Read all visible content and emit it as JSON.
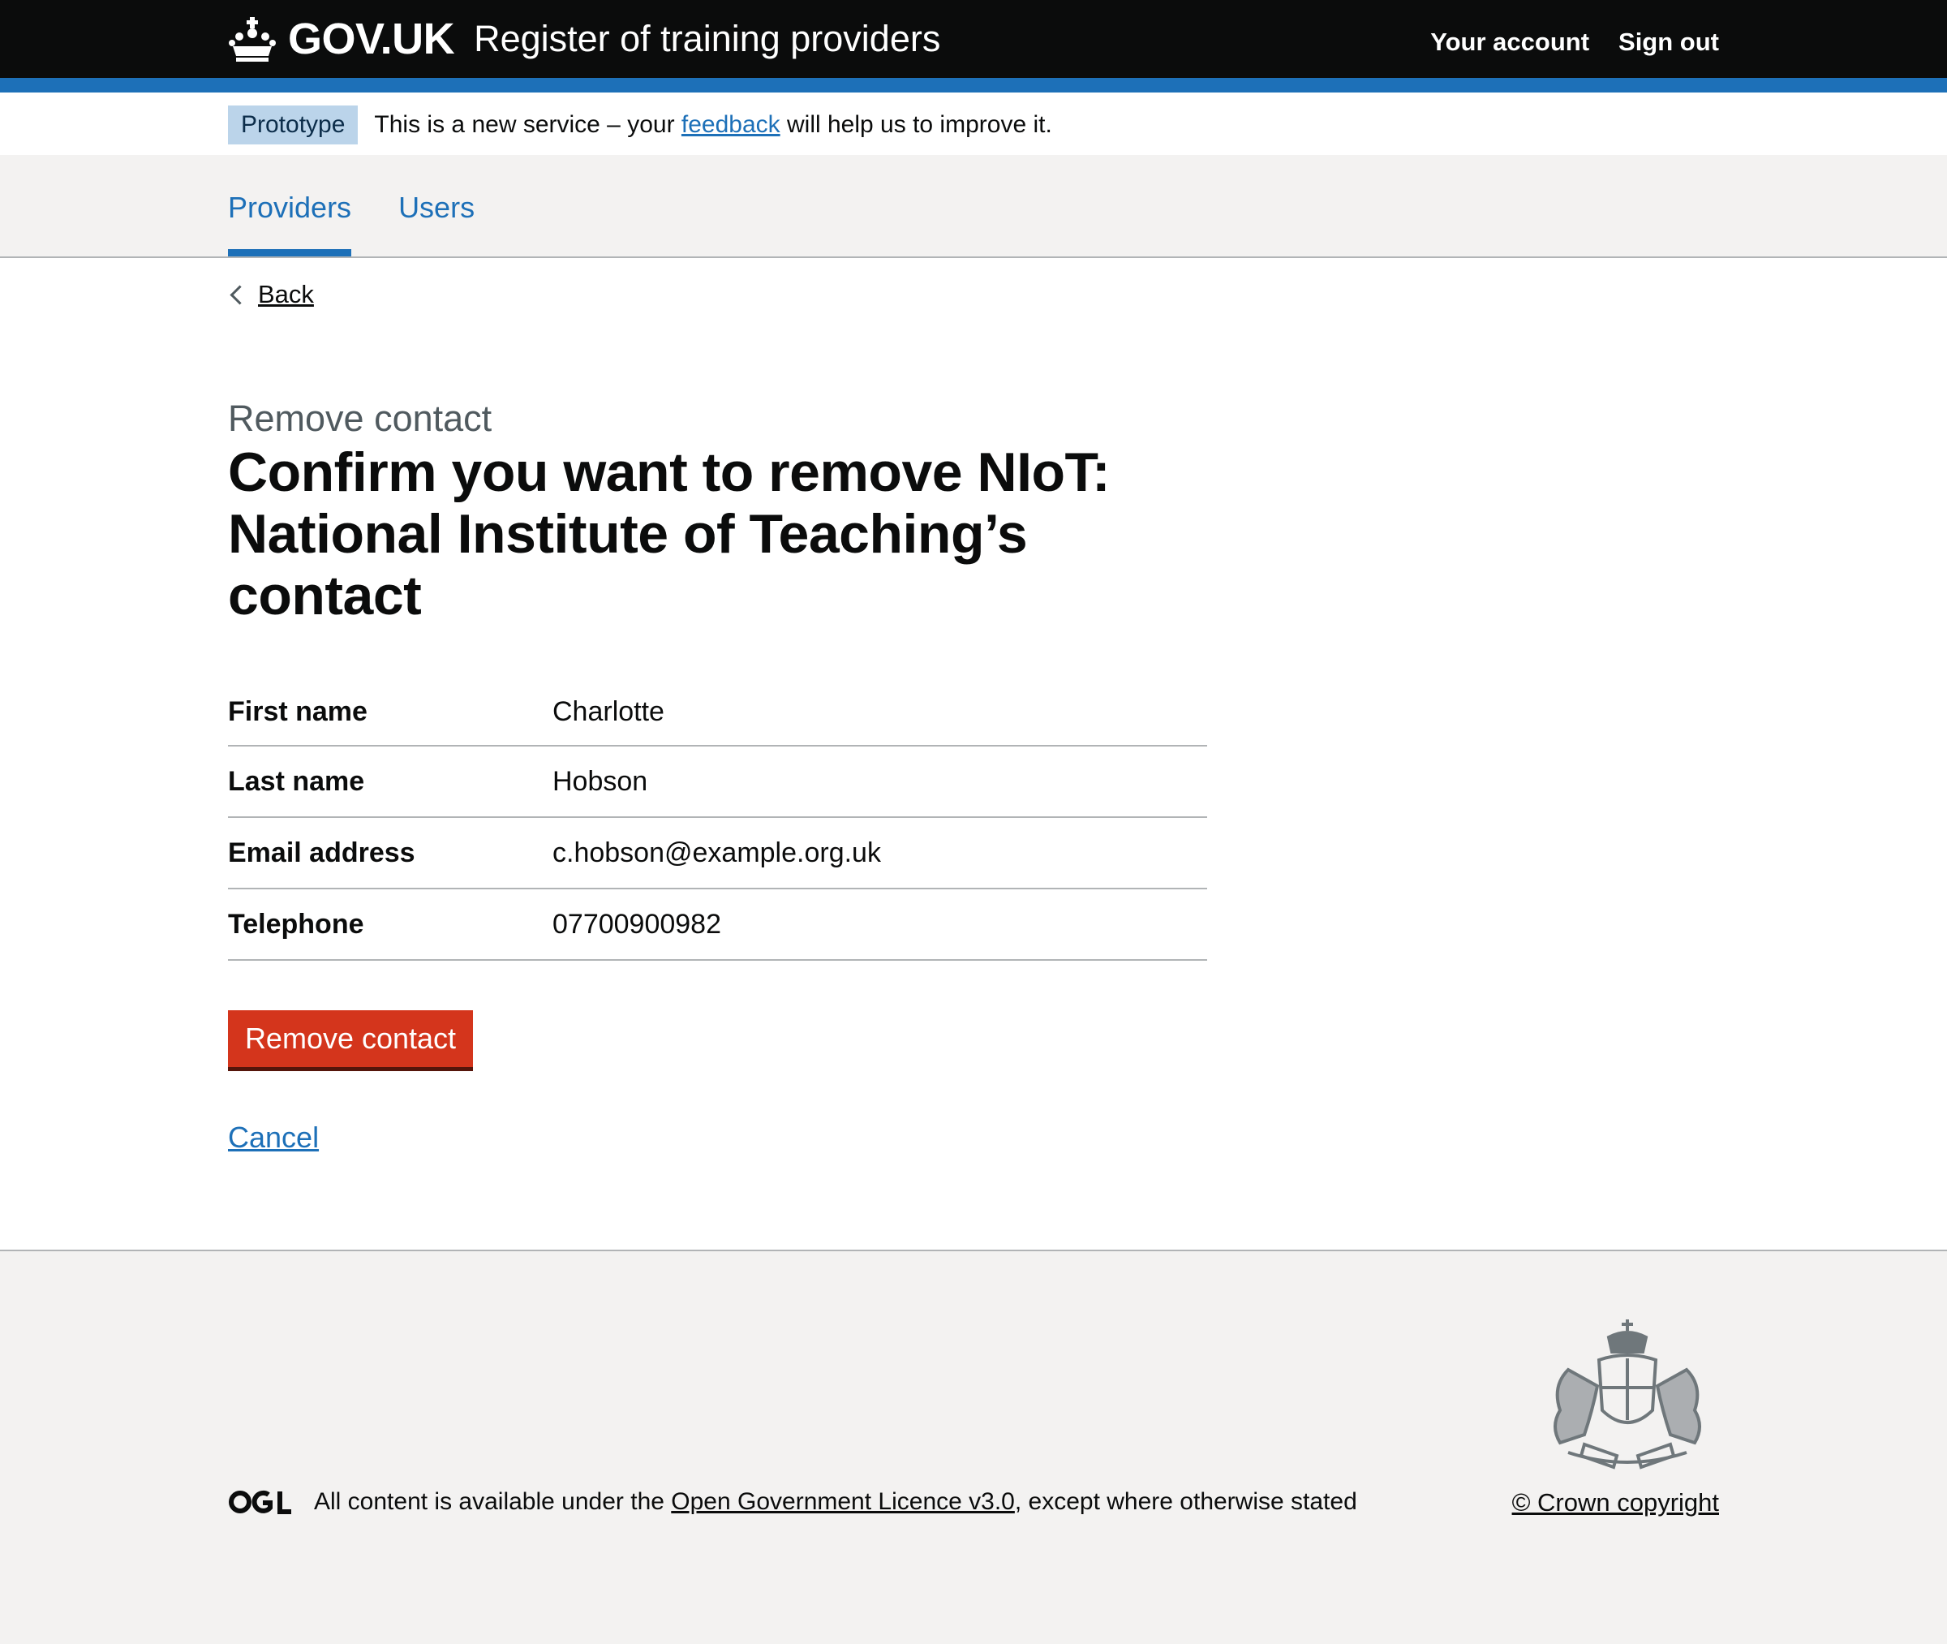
{
  "header": {
    "logo_text": "GOV.UK",
    "service_name": "Register of training providers",
    "nav": [
      "Your account",
      "Sign out"
    ]
  },
  "phase_banner": {
    "tag": "Prototype",
    "text_before": "This is a new service – your ",
    "link_text": "feedback",
    "text_after": " will help us to improve it."
  },
  "primary_nav": {
    "items": [
      "Providers",
      "Users"
    ],
    "active": "Providers"
  },
  "back_link": "Back",
  "caption": "Remove contact",
  "title": "Confirm you want to remove NIoT: National Institute of Teaching’s contact",
  "summary": [
    {
      "key": "First name",
      "value": "Charlotte"
    },
    {
      "key": "Last name",
      "value": "Hobson"
    },
    {
      "key": "Email address",
      "value": "c.hobson@example.org.uk"
    },
    {
      "key": "Telephone",
      "value": "07700900982"
    }
  ],
  "remove_button": "Remove contact",
  "cancel_link": "Cancel",
  "footer": {
    "licence_before": "All content is available under the ",
    "licence_link": "Open Government Licence v3.0",
    "licence_after": ", except where otherwise stated",
    "copyright": "© Crown copyright"
  },
  "colors": {
    "brand_blue": "#1d70b8",
    "header_black": "#0b0c0c",
    "warning_red": "#d4351c",
    "footer_grey": "#f3f2f1"
  },
  "icons": [
    "crown-icon",
    "chevron-left-icon",
    "ogl-icon",
    "royal-crest-icon"
  ]
}
